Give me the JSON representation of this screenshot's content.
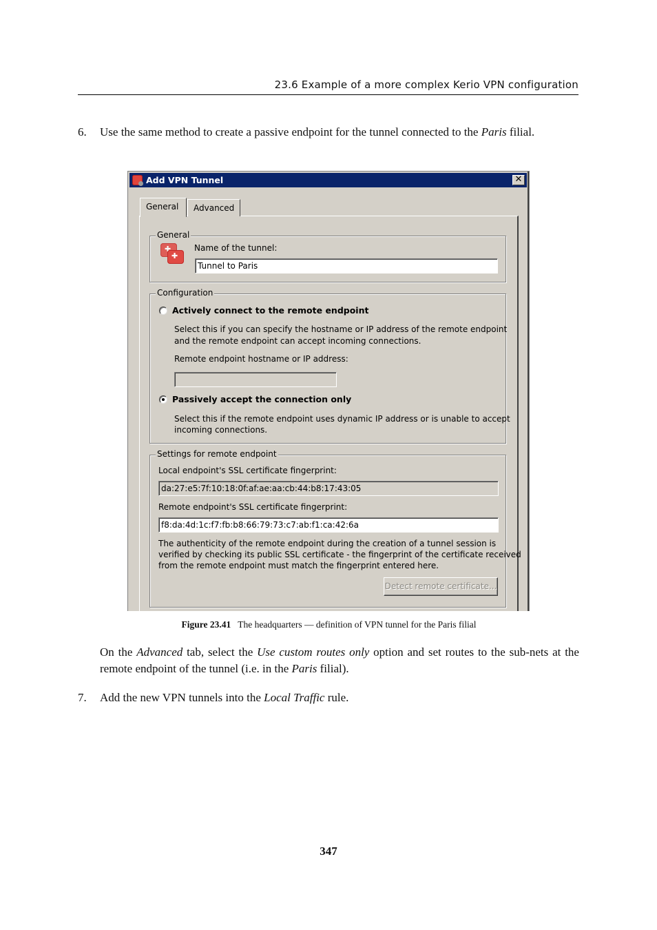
{
  "running_head": "23.6  Example of a more complex Kerio VPN configuration",
  "step6": {
    "number": "6.",
    "text_before": "Use the same method to create a passive endpoint for the tunnel connected to the ",
    "italic": "Paris",
    "text_after": " filial."
  },
  "dialog": {
    "title": "Add VPN Tunnel",
    "close_label": "✕",
    "tabs": [
      {
        "label": "General",
        "active": true
      },
      {
        "label": "Advanced",
        "active": false
      }
    ],
    "general_group": {
      "label": "General",
      "name_label": "Name of the tunnel:",
      "name_value": "Tunnel to Paris"
    },
    "configuration_group": {
      "label": "Configuration",
      "active_option": {
        "label": "Actively connect to the remote endpoint",
        "checked": false,
        "description_line1": "Select this if you can specify the hostname or IP address of the remote endpoint",
        "description_line2": "and the remote endpoint can accept incoming connections.",
        "hostname_label": "Remote endpoint hostname or IP address:",
        "hostname_value": ""
      },
      "passive_option": {
        "label": "Passively accept the connection only",
        "checked": true,
        "description_line1": "Select this if the remote endpoint uses dynamic IP address or is unable to accept",
        "description_line2": "incoming connections."
      }
    },
    "remote_settings_group": {
      "label": "Settings for remote endpoint",
      "local_fp_label": "Local endpoint's SSL certificate fingerprint:",
      "local_fp_value": "da:27:e5:7f:10:18:0f:af:ae:aa:cb:44:b8:17:43:05",
      "remote_fp_label": "Remote endpoint's SSL certificate fingerprint:",
      "remote_fp_value": "f8:da:4d:1c:f7:fb:b8:66:79:73:c7:ab:f1:ca:42:6a",
      "note_line1": "The authenticity of the remote endpoint during the creation of a tunnel session is",
      "note_line2": "verified by checking its public SSL certificate - the fingerprint of the certificate received",
      "note_line3": "from the remote endpoint must match the fingerprint entered here.",
      "detect_button": "Detect remote certificate..."
    }
  },
  "caption": {
    "label": "Figure 23.41",
    "text": "The headquarters — definition of VPN tunnel for the Paris filial"
  },
  "advanced_para": {
    "t1": "On the ",
    "i1": "Advanced",
    "t2": " tab, select the ",
    "i2": "Use custom routes only",
    "t3": " option and set routes to the sub-nets at the remote endpoint of the tunnel (i.e. in the ",
    "i3": "Paris",
    "t4": " filial)."
  },
  "step7": {
    "number": "7.",
    "text_before": "Add the new VPN tunnels into the ",
    "italic": "Local Traffic",
    "text_after": " rule."
  },
  "page_number": "347"
}
